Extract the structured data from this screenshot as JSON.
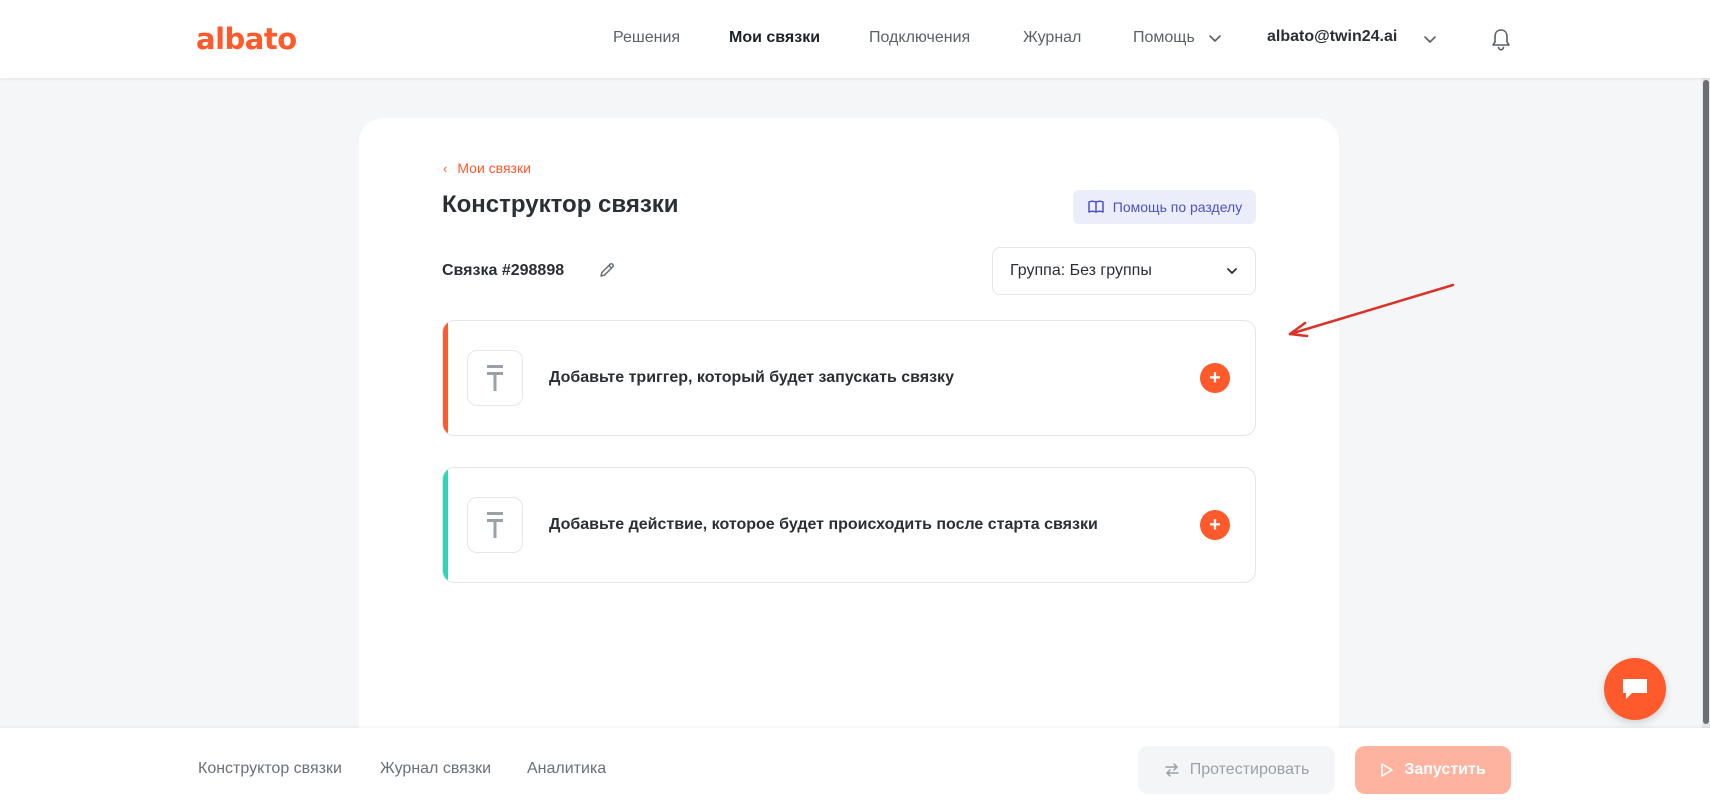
{
  "header": {
    "logo": "albato",
    "nav": {
      "solutions": "Решения",
      "my_connections": "Мои связки",
      "connections": "Подключения",
      "journal": "Журнал",
      "help": "Помощь"
    },
    "user_email": "albato@twin24.ai"
  },
  "main": {
    "back_link": "Мои связки",
    "title": "Конструктор связки",
    "help_button": "Помощь по разделу",
    "connection_name": "Связка #298898",
    "group_select": "Группа: Без группы",
    "steps": [
      {
        "text": "Добавьте триггер, который будет запускать связку",
        "accent": "#ff5a2c"
      },
      {
        "text": "Добавьте действие, которое будет происходить после старта связки",
        "accent": "#2fd6b5"
      }
    ],
    "plus_symbol": "+"
  },
  "bottom": {
    "tabs": [
      "Конструктор связки",
      "Журнал связки",
      "Аналитика"
    ],
    "test_button": "Протестировать",
    "run_button": "Запустить"
  },
  "colors": {
    "brand": "#ff5a2c",
    "help_bg": "#ecedfb",
    "help_text": "#4a53c4",
    "action_accent": "#2fd6b5",
    "annotation_arrow": "#d9342b"
  }
}
